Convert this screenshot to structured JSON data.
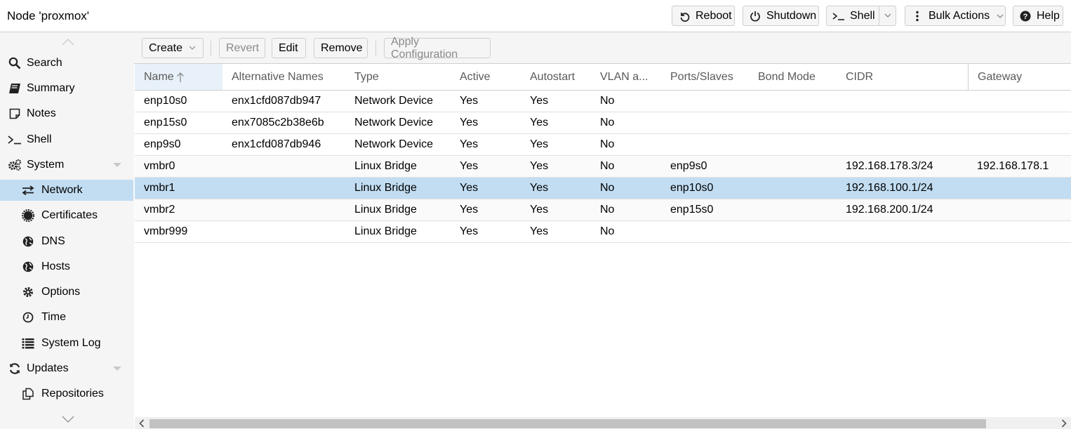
{
  "header": {
    "title": "Node 'proxmox'",
    "reboot": "Reboot",
    "shutdown": "Shutdown",
    "shell": "Shell",
    "bulk_actions": "Bulk Actions",
    "help": "Help"
  },
  "sidebar": {
    "items": [
      {
        "label": "Search",
        "icon": "search-icon"
      },
      {
        "label": "Summary",
        "icon": "book-icon"
      },
      {
        "label": "Notes",
        "icon": "note-icon"
      },
      {
        "label": "Shell",
        "icon": "terminal-icon"
      },
      {
        "label": "System",
        "icon": "gears-icon"
      },
      {
        "label": "Network",
        "icon": "exchange-icon"
      },
      {
        "label": "Certificates",
        "icon": "certificate-icon"
      },
      {
        "label": "DNS",
        "icon": "globe-icon"
      },
      {
        "label": "Hosts",
        "icon": "globe-icon"
      },
      {
        "label": "Options",
        "icon": "gear-icon"
      },
      {
        "label": "Time",
        "icon": "clock-icon"
      },
      {
        "label": "System Log",
        "icon": "list-icon"
      },
      {
        "label": "Updates",
        "icon": "refresh-icon"
      },
      {
        "label": "Repositories",
        "icon": "copy-icon"
      }
    ]
  },
  "toolbar": {
    "create": "Create",
    "revert": "Revert",
    "edit": "Edit",
    "remove": "Remove",
    "apply": "Apply Configuration"
  },
  "grid": {
    "columns": [
      "Name",
      "Alternative Names",
      "Type",
      "Active",
      "Autostart",
      "VLAN a...",
      "Ports/Slaves",
      "Bond Mode",
      "CIDR",
      "Gateway"
    ],
    "rows": [
      [
        "enp10s0",
        "enx1cfd087db947",
        "Network Device",
        "Yes",
        "Yes",
        "No",
        "",
        "",
        "",
        ""
      ],
      [
        "enp15s0",
        "enx7085c2b38e6b",
        "Network Device",
        "Yes",
        "Yes",
        "No",
        "",
        "",
        "",
        ""
      ],
      [
        "enp9s0",
        "enx1cfd087db946",
        "Network Device",
        "Yes",
        "Yes",
        "No",
        "",
        "",
        "",
        ""
      ],
      [
        "vmbr0",
        "",
        "Linux Bridge",
        "Yes",
        "Yes",
        "No",
        "enp9s0",
        "",
        "192.168.178.3/24",
        "192.168.178.1"
      ],
      [
        "vmbr1",
        "",
        "Linux Bridge",
        "Yes",
        "Yes",
        "No",
        "enp10s0",
        "",
        "192.168.100.1/24",
        ""
      ],
      [
        "vmbr2",
        "",
        "Linux Bridge",
        "Yes",
        "Yes",
        "No",
        "enp15s0",
        "",
        "192.168.200.1/24",
        ""
      ],
      [
        "vmbr999",
        "",
        "Linux Bridge",
        "Yes",
        "Yes",
        "No",
        "",
        "",
        "",
        ""
      ]
    ],
    "selected_row": "vmbr1"
  },
  "colors": {
    "selected": "#c2ddf2",
    "sidebar_bg": "#f5f5f5",
    "border": "#cfcfcf"
  }
}
